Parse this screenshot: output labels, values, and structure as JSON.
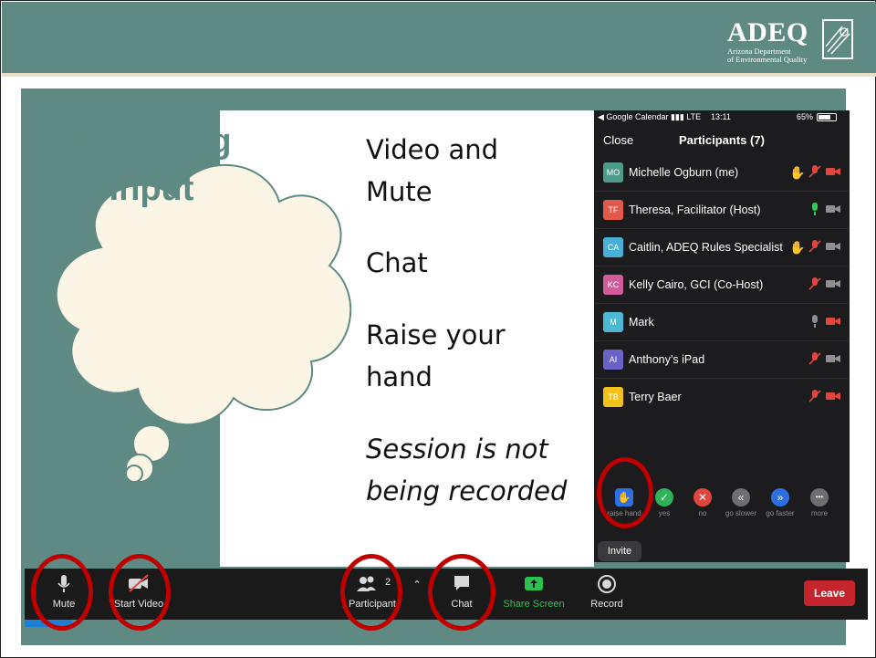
{
  "header": {
    "logo_word": "ADEQ",
    "logo_sub_line1": "Arizona Department",
    "logo_sub_line2": "of Environmental Quality"
  },
  "cloud": {
    "line1": "Providing",
    "line2": "Input"
  },
  "slide_text": {
    "item1_line1": "Video and",
    "item1_line2": "Mute",
    "item2": "Chat",
    "item3_line1": "Raise your",
    "item3_line2": "hand",
    "item4_line1": "Session is not",
    "item4_line2": "being recorded"
  },
  "phone": {
    "status_left": "◀ Google Calendar ▮▮▮ LTE",
    "time": "13:11",
    "battery": "65%",
    "close_label": "Close",
    "title": "Participants (7)",
    "participants": [
      {
        "initials": "MO",
        "name": "Michelle Ogburn (me)",
        "color": "#4e9a8b"
      },
      {
        "initials": "TF",
        "name": "Theresa, Facilitator (Host)",
        "color": "#e2584b"
      },
      {
        "initials": "CA",
        "name": "Caitlin, ADEQ Rules Specialist",
        "color": "#47b0d6"
      },
      {
        "initials": "KC",
        "name": "Kelly Cairo, GCI (Co-Host)",
        "color": "#d15b9b"
      },
      {
        "initials": "M",
        "name": "Mark",
        "color": "#4cb8d1"
      },
      {
        "initials": "AI",
        "name": "Anthony’s iPad",
        "color": "#6b62c7"
      },
      {
        "initials": "TB",
        "name": "Terry Baer",
        "color": "#f2c21b"
      }
    ],
    "reactions": [
      {
        "label": "raise hand",
        "glyph": "✋",
        "color": "#2d6ee0"
      },
      {
        "label": "yes",
        "glyph": "✓",
        "color": "#2fb25a"
      },
      {
        "label": "no",
        "glyph": "✕",
        "color": "#e0463e"
      },
      {
        "label": "go slower",
        "glyph": "«",
        "color": "#6d6d72"
      },
      {
        "label": "go faster",
        "glyph": "»",
        "color": "#2d6ee0"
      },
      {
        "label": "more",
        "glyph": "•••",
        "color": "#6d6d72"
      }
    ],
    "invite_label": "Invite"
  },
  "toolbar": {
    "mute": "Mute",
    "start_video": "Start Video",
    "participants": "Participant",
    "participants_count": "2",
    "chat": "Chat",
    "share_screen": "Share Screen",
    "record": "Record",
    "leave": "Leave"
  },
  "colors": {
    "teal": "#5f8a83",
    "highlight": "#c00000",
    "leave": "#c4242b",
    "share_green": "#2bc150"
  }
}
